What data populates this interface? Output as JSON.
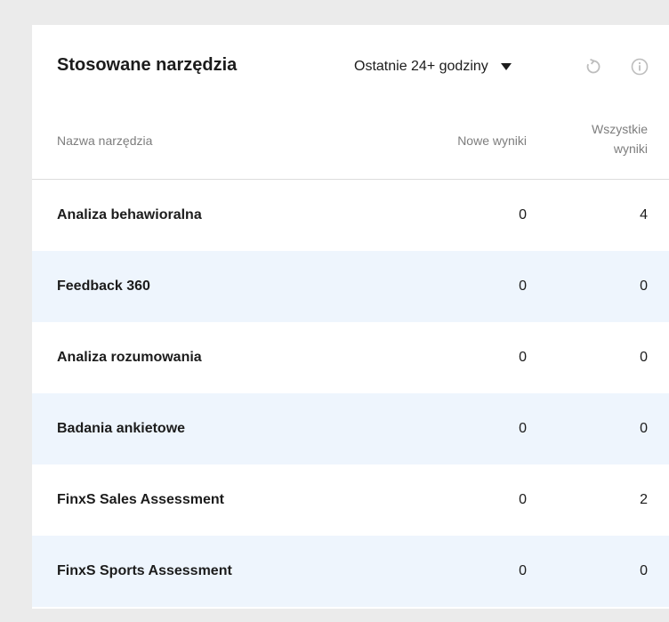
{
  "widget": {
    "title": "Stosowane narzędzia",
    "period": "Ostatnie 24+ godziny",
    "icons": {
      "dropdown": "caret-down-icon",
      "refresh": "refresh-icon",
      "info": "info-icon"
    }
  },
  "table": {
    "headers": {
      "name": "Nazwa narzędzia",
      "new_results": "Nowe wyniki",
      "all_results_line1": "Wszystkie",
      "all_results_line2": "wyniki"
    },
    "rows": [
      {
        "name": "Analiza behawioralna",
        "new": "0",
        "all": "4"
      },
      {
        "name": "Feedback 360",
        "new": "0",
        "all": "0"
      },
      {
        "name": "Analiza rozumowania",
        "new": "0",
        "all": "0"
      },
      {
        "name": "Badania ankietowe",
        "new": "0",
        "all": "0"
      },
      {
        "name": "FinxS Sales Assessment",
        "new": "0",
        "all": "2"
      },
      {
        "name": "FinxS Sports Assessment",
        "new": "0",
        "all": "0"
      }
    ]
  },
  "colors": {
    "row_alt": "#eef5fd",
    "icon_gray": "#bdbdbd"
  }
}
